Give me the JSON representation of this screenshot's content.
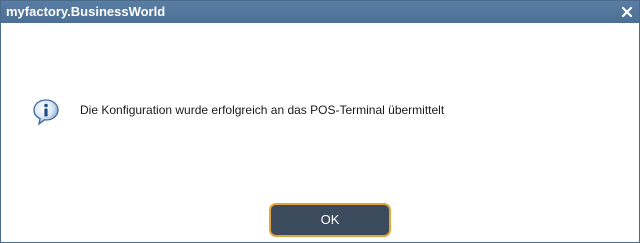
{
  "window": {
    "title": "myfactory.BusinessWorld"
  },
  "dialog": {
    "message": "Die Konfiguration wurde erfolgreich an das POS-Terminal übermittelt",
    "ok_label": "OK",
    "icon": "info-icon"
  },
  "colors": {
    "titlebar": "#4b6f95",
    "button_bg": "#3b4a5c",
    "button_border": "#e3a63a"
  }
}
